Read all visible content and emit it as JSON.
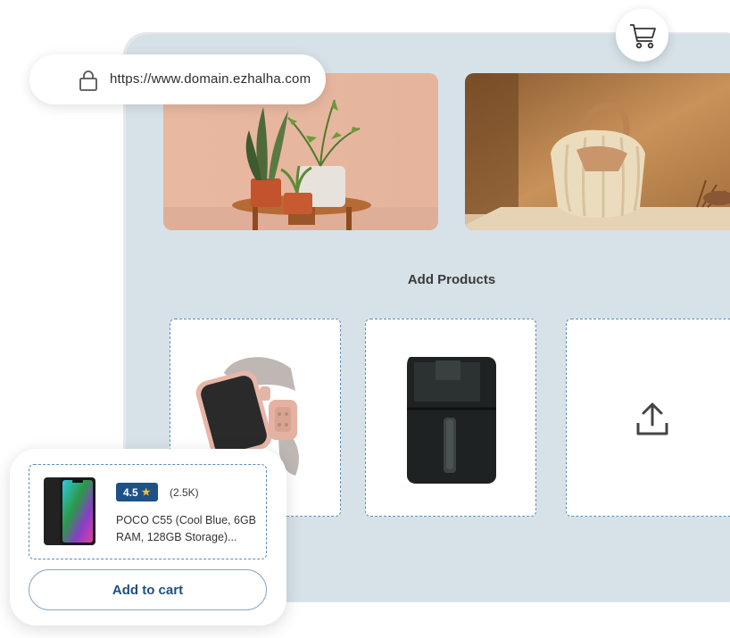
{
  "browser": {
    "url": "https://www.domain.ezhalha.com",
    "lock_icon": "lock-icon"
  },
  "header": {
    "cart_icon": "shopping-cart-icon"
  },
  "banners": [
    {
      "name": "plants-banner"
    },
    {
      "name": "handbag-banner"
    }
  ],
  "section": {
    "title": "Add Products"
  },
  "product_slots": [
    {
      "name": "smartwatch"
    },
    {
      "name": "air-fryer"
    },
    {
      "name": "upload",
      "icon": "upload-icon"
    }
  ],
  "product_card": {
    "rating": "4.5",
    "rating_star": "★",
    "review_count": "(2.5K)",
    "product_name": "POCO C55 (Cool Blue, 6GB RAM, 128GB Storage)...",
    "add_to_cart_label": "Add to cart"
  },
  "colors": {
    "panel_bg": "#d6e2e8",
    "accent_blue": "#1e5286",
    "dashed_border": "#5b8db8",
    "star": "#f4c430"
  }
}
